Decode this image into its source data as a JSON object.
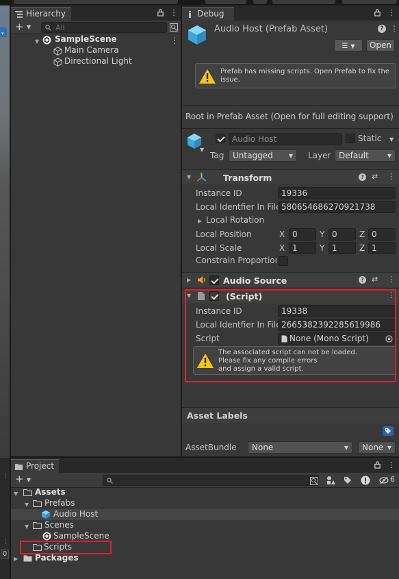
{
  "hierarchy": {
    "tab_label": "Hierarchy",
    "search_placeholder": "All",
    "items": [
      {
        "label": "SampleScene"
      },
      {
        "label": "Main Camera"
      },
      {
        "label": "Directional Light"
      }
    ]
  },
  "inspector": {
    "tab_label": "Debug",
    "title": "Audio Host (Prefab Asset)",
    "open_label": "Open",
    "warning_text_1": "Prefab has missing scripts. Open Prefab to fix the",
    "warning_text_2": "issue.",
    "root_text": "Root in Prefab Asset (Open for full editing support)",
    "object_name": "Audio Host",
    "static_label": "Static",
    "tag_label": "Tag",
    "tag_value": "Untagged",
    "layer_label": "Layer",
    "layer_value": "Default",
    "transform": {
      "title": "Transform",
      "instance_id_label": "Instance ID",
      "instance_id": "19336",
      "local_identifier_label": "Local Identfier In File",
      "local_identifier": "580654686270921738",
      "local_rotation_label": "Local Rotation",
      "local_position_label": "Local Position",
      "position": {
        "x": "0",
        "y": "0",
        "z": "0"
      },
      "local_scale_label": "Local Scale",
      "scale": {
        "x": "1",
        "y": "1",
        "z": "1"
      },
      "constrain_label": "Constrain Proportions",
      "axis_x": "X",
      "axis_y": "Y",
      "axis_z": "Z"
    },
    "audio_source": {
      "title": "Audio Source"
    },
    "script_component": {
      "title": "(Script)",
      "instance_id_label": "Instance ID",
      "instance_id": "19338",
      "local_identifier_label": "Local Identfier In File",
      "local_identifier": "2665382392285619986",
      "script_label": "Script",
      "script_value": "None (Mono Script)",
      "warning_line_1": "The associated script can not be loaded.",
      "warning_line_2": "Please fix any compile errors",
      "warning_line_3": "and assign a valid script."
    },
    "asset_labels_title": "Asset Labels",
    "assetbundle_label": "AssetBundle",
    "assetbundle_value": "None",
    "assetbundle_variant": "None"
  },
  "project": {
    "tab_label": "Project",
    "hidden_count": "6",
    "tree": [
      {
        "label": "Assets"
      },
      {
        "label": "Prefabs"
      },
      {
        "label": "Audio Host"
      },
      {
        "label": "Scenes"
      },
      {
        "label": "SampleScene"
      },
      {
        "label": "Scripts"
      },
      {
        "label": "Packages"
      }
    ]
  },
  "colors": {
    "highlight_outline": "#e01f2a",
    "warning_yellow": "#f4c51b",
    "prefab_blue": "#4cc3f0"
  }
}
